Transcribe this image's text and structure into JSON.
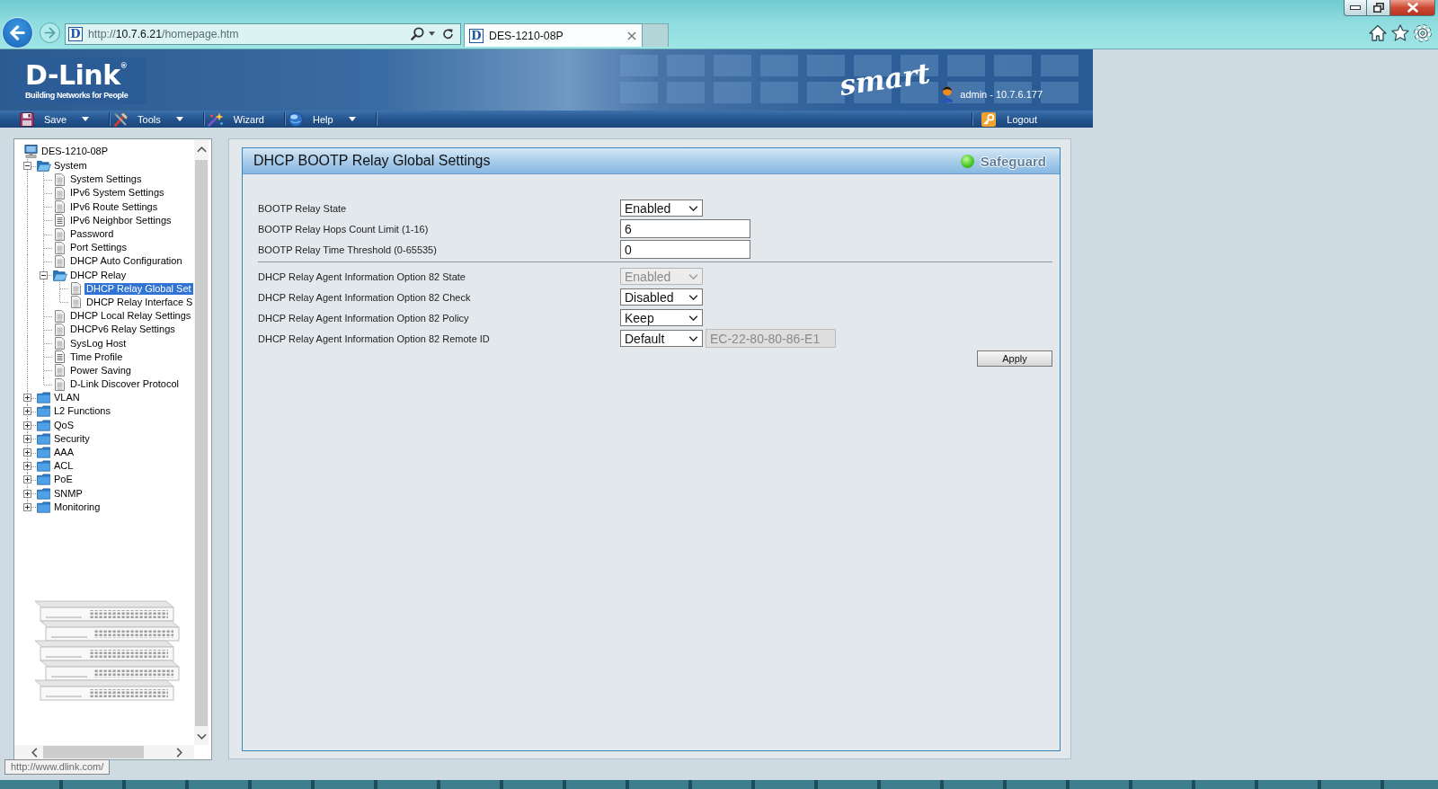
{
  "browser": {
    "address": {
      "favicon": "D",
      "scheme": "http://",
      "host": "10.7.6.21",
      "path": "/homepage.htm"
    },
    "tabs": [
      {
        "favicon": "D",
        "title": "DES-1210-08P",
        "selected": true
      }
    ],
    "status_tooltip": "http://www.dlink.com/"
  },
  "header": {
    "logo": "D-Link$^{®}$",
    "tagline": "Building Networks for People",
    "edition": "smart",
    "user": "admin - 10.7.6.177"
  },
  "menu": {
    "items": [
      {
        "label": "Save",
        "dropdown": true
      },
      {
        "label": "Tools",
        "dropdown": true
      },
      {
        "label": "Wizard",
        "dropdown": false
      },
      {
        "label": "Help",
        "dropdown": true
      }
    ],
    "logout": "Logout"
  },
  "tree": {
    "label": "DES-1210-08P",
    "kind": "device",
    "selected": false,
    "children": [
      {
        "label": "System",
        "kind": "folder",
        "expanded": true,
        "selected": false,
        "children": [
          {
            "label": "System Settings",
            "kind": "page",
            "selected": false
          },
          {
            "label": "IPv6 System Settings",
            "kind": "page",
            "selected": false
          },
          {
            "label": "IPv6 Route Settings",
            "kind": "page",
            "selected": false
          },
          {
            "label": "IPv6 Neighbor Settings",
            "kind": "textpage",
            "selected": false
          },
          {
            "label": "Password",
            "kind": "page",
            "selected": false
          },
          {
            "label": "Port Settings",
            "kind": "page",
            "selected": false
          },
          {
            "label": "DHCP Auto Configuration",
            "kind": "page",
            "selected": false
          },
          {
            "label": "DHCP Relay",
            "kind": "folder",
            "expanded": true,
            "selected": false,
            "children": [
              {
                "label": "DHCP Relay Global Set",
                "kind": "page",
                "selected": true
              },
              {
                "label": "DHCP Relay Interface S",
                "kind": "page",
                "selected": false
              }
            ]
          },
          {
            "label": "DHCP Local Relay Settings",
            "kind": "page",
            "selected": false
          },
          {
            "label": "DHCPv6 Relay Settings",
            "kind": "page",
            "selected": false
          },
          {
            "label": "SysLog Host",
            "kind": "page",
            "selected": false
          },
          {
            "label": "Time Profile",
            "kind": "textpage",
            "selected": false
          },
          {
            "label": "Power Saving",
            "kind": "page",
            "selected": false
          },
          {
            "label": "D-Link Discover Protocol",
            "kind": "page",
            "selected": false
          }
        ]
      },
      {
        "label": "VLAN",
        "kind": "folder",
        "expanded": false,
        "selected": false
      },
      {
        "label": "L2 Functions",
        "kind": "folder",
        "expanded": false,
        "selected": false
      },
      {
        "label": "QoS",
        "kind": "folder",
        "expanded": false,
        "selected": false
      },
      {
        "label": "Security",
        "kind": "folder",
        "expanded": false,
        "selected": false
      },
      {
        "label": "AAA",
        "kind": "folder",
        "expanded": false,
        "selected": false
      },
      {
        "label": "ACL",
        "kind": "folder",
        "expanded": false,
        "selected": false
      },
      {
        "label": "PoE",
        "kind": "folder",
        "expanded": false,
        "selected": false
      },
      {
        "label": "SNMP",
        "kind": "folder",
        "expanded": false,
        "selected": false
      },
      {
        "label": "Monitoring",
        "kind": "folder",
        "expanded": false,
        "selected": false
      }
    ]
  },
  "panel": {
    "title": "DHCP BOOTP Relay Global Settings",
    "safeguard": {
      "label": "Safeguard",
      "on": true
    },
    "sections": [
      {
        "fields": [
          {
            "label": "BOOTP Relay State",
            "kind": "select",
            "value": "Enabled",
            "disabled": false
          },
          {
            "label": "BOOTP Relay Hops Count Limit (1-16)",
            "kind": "text",
            "value": "6",
            "disabled": false
          },
          {
            "label": "BOOTP Relay Time Threshold (0-65535)",
            "kind": "text",
            "value": "0",
            "disabled": false
          }
        ]
      },
      {
        "fields": [
          {
            "label": "DHCP Relay Agent Information Option 82 State",
            "kind": "select",
            "value": "Enabled",
            "disabled": true
          },
          {
            "label": "DHCP Relay Agent Information Option 82 Check",
            "kind": "select",
            "value": "Disabled",
            "disabled": false
          },
          {
            "label": "DHCP Relay Agent Information Option 82 Policy",
            "kind": "select",
            "value": "Keep",
            "disabled": false
          },
          {
            "label": "DHCP Relay Agent Information Option 82 Remote ID",
            "kind": "select",
            "value": "Default",
            "disabled": false,
            "extra": {
              "value": "EC-22-80-80-86-E1",
              "disabled": true
            }
          }
        ]
      }
    ],
    "apply": "Apply"
  }
}
